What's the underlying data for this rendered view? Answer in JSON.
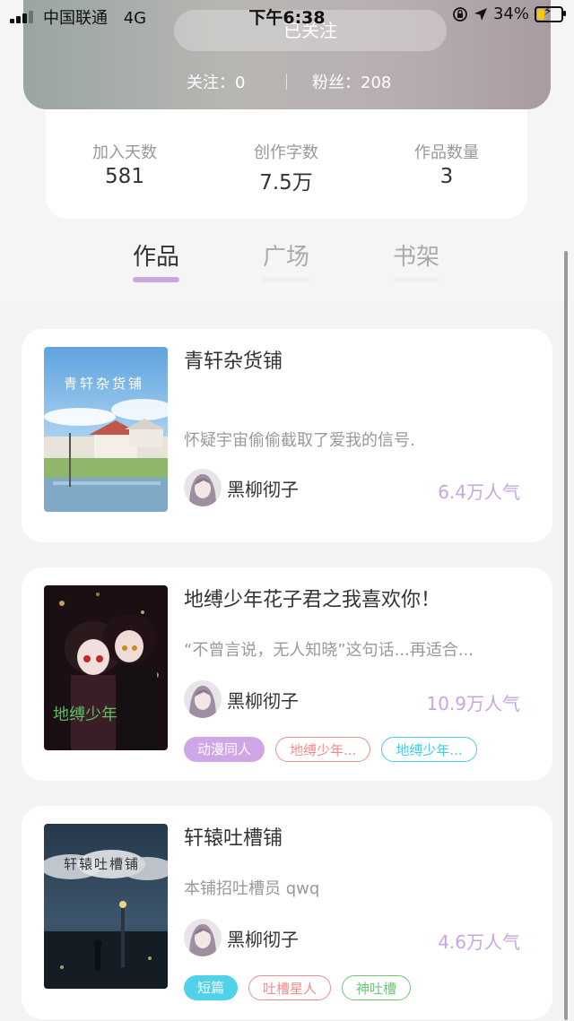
{
  "status_bar": {
    "carrier": "中国联通",
    "network": "4G",
    "time": "下午6:38",
    "battery": "34%",
    "battery_level": 0.34
  },
  "header": {
    "follow_button": "已关注",
    "following": "关注：0",
    "fans": "粉丝：208"
  },
  "stats": [
    {
      "label": "加入天数",
      "value": "581"
    },
    {
      "label": "创作字数",
      "value": "7.5万"
    },
    {
      "label": "作品数量",
      "value": "3"
    }
  ],
  "tabs": [
    {
      "label": "作品",
      "active": true
    },
    {
      "label": "广场",
      "active": false
    },
    {
      "label": "书架",
      "active": false
    }
  ],
  "works": [
    {
      "title": "青轩杂货铺",
      "cover_text": "青轩杂货铺",
      "description": "怀疑宇宙偷偷截取了爱我的信号.",
      "author": "黑柳彻子",
      "popularity": "6.4万人气",
      "tags": []
    },
    {
      "title": "地缚少年花子君之我喜欢你！",
      "cover_text": "",
      "description": "“不曾言说，无人知晓”这句话...再适合...",
      "author": "黑柳彻子",
      "popularity": "10.9万人气",
      "tags": [
        {
          "label": "动漫同人",
          "style": "solid-purple"
        },
        {
          "label": "地缚少年...",
          "style": "o-red"
        },
        {
          "label": "地缚少年...",
          "style": "o-blue"
        }
      ]
    },
    {
      "title": "轩辕吐槽铺",
      "cover_text": "轩辕吐槽铺",
      "description": "本铺招吐槽员 qwq",
      "author": "黑柳彻子",
      "popularity": "4.6万人气",
      "tags": [
        {
          "label": "短篇",
          "style": "solid-blue"
        },
        {
          "label": "吐槽星人",
          "style": "o-red"
        },
        {
          "label": "神吐槽",
          "style": "o-green"
        }
      ]
    }
  ],
  "colors": {
    "accent": "#c9a6e0",
    "tag_blue": "#4fd2ea",
    "tag_red": "#f08e8e",
    "tag_green": "#6cc77b"
  }
}
